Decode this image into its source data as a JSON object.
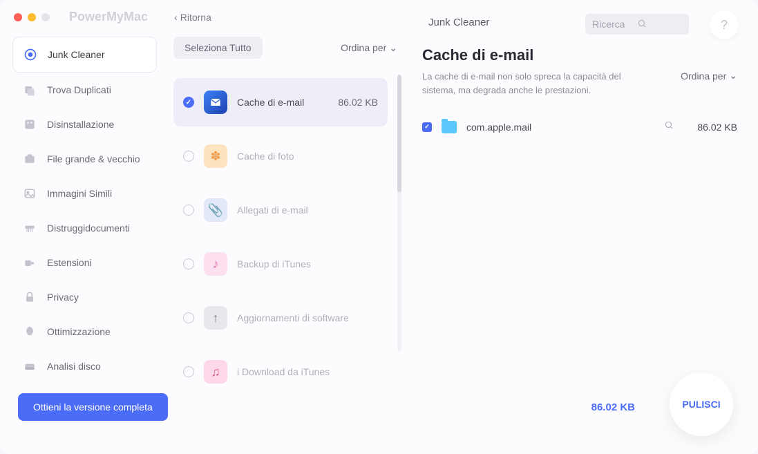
{
  "app_title": "PowerMyMac",
  "back_label": "Ritorna",
  "header_title": "Junk Cleaner",
  "search_placeholder": "Ricerca",
  "help_glyph": "?",
  "sidebar": {
    "items": [
      {
        "label": "Junk Cleaner"
      },
      {
        "label": "Trova Duplicati"
      },
      {
        "label": "Disinstallazione"
      },
      {
        "label": "File grande & vecchio"
      },
      {
        "label": "Immagini Simili"
      },
      {
        "label": "Distruggidocumenti"
      },
      {
        "label": "Estensioni"
      },
      {
        "label": "Privacy"
      },
      {
        "label": "Ottimizzazione"
      },
      {
        "label": "Analisi disco"
      }
    ]
  },
  "middle": {
    "select_all": "Seleziona Tutto",
    "sort_by": "Ordina per",
    "categories": [
      {
        "label": "Cache di e-mail",
        "size": "86.02 KB"
      },
      {
        "label": "Cache di foto"
      },
      {
        "label": "Allegati di e-mail"
      },
      {
        "label": "Backup di iTunes"
      },
      {
        "label": "Aggiornamenti di software"
      },
      {
        "label": "i Download da iTunes"
      }
    ]
  },
  "detail": {
    "title": "Cache di e-mail",
    "desc": "La cache di e-mail non solo spreca la capacità del sistema, ma degrada anche le prestazioni.",
    "sort_by": "Ordina per",
    "files": [
      {
        "name": "com.apple.mail",
        "size": "86.02 KB"
      }
    ]
  },
  "footer": {
    "upgrade": "Ottieni la versione completa",
    "total": "86.02 KB",
    "clean": "PULISCI"
  }
}
